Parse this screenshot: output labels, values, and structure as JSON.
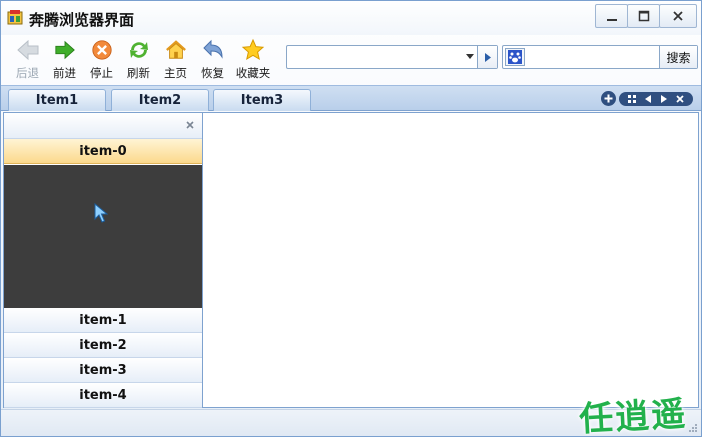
{
  "window": {
    "title": "奔腾浏览器界面",
    "minimize_icon": "minimize-icon",
    "maximize_icon": "maximize-icon",
    "close_icon": "close-icon"
  },
  "toolbar": {
    "back_label": "后退",
    "forward_label": "前进",
    "stop_label": "停止",
    "refresh_label": "刷新",
    "home_label": "主页",
    "restore_label": "恢复",
    "favorites_label": "收藏夹"
  },
  "address": {
    "value": ""
  },
  "search": {
    "value": "",
    "button_label": "搜索"
  },
  "tabs": [
    {
      "label": "Item1"
    },
    {
      "label": "Item2"
    },
    {
      "label": "Item3"
    }
  ],
  "left_panel": {
    "items": [
      {
        "label": "item-0",
        "active": true
      },
      {
        "label": "item-1"
      },
      {
        "label": "item-2"
      },
      {
        "label": "item-3"
      },
      {
        "label": "item-4"
      }
    ]
  },
  "watermark": {
    "text": "任逍遥"
  },
  "colors": {
    "accent": "#2f4f80",
    "active_item": "#fbd98c",
    "panel_body": "#3d3d3d",
    "watermark": "#22b14c"
  }
}
